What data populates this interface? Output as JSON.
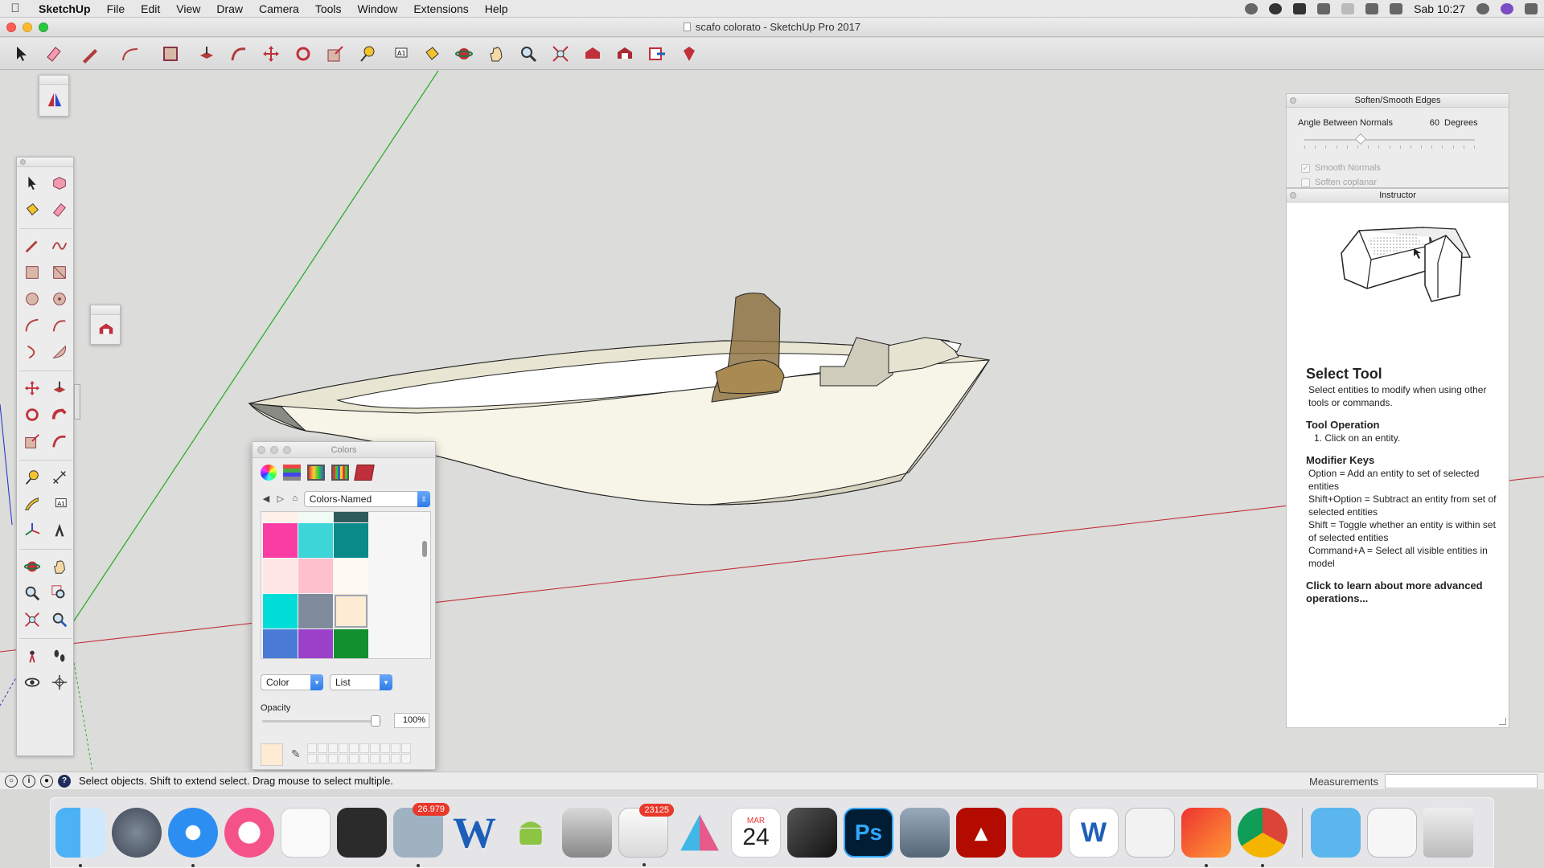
{
  "menubar": {
    "apple_icon": "apple-logo",
    "items": [
      "SketchUp",
      "File",
      "Edit",
      "View",
      "Draw",
      "Camera",
      "Tools",
      "Window",
      "Extensions",
      "Help"
    ],
    "clock": "Sab 10:27"
  },
  "window": {
    "title": "scafo colorato - SketchUp Pro 2017"
  },
  "colors_panel": {
    "title": "Colors",
    "palette_select": "Colors-Named",
    "mode_select": "Color",
    "view_select": "List",
    "opacity_label": "Opacity",
    "opacity_value": "100%",
    "opacity_fraction": 0.95,
    "selected_color": "#fdebd3",
    "swatches": [
      "#fdf1ea",
      "#effbf4",
      "#2f5b5d",
      "#fb3ea3",
      "#3dd5d8",
      "#0b8a8a",
      "#fee5e6",
      "#fec0cd",
      "#fefaf1",
      "#00dcd7",
      "#7f8b9a",
      "#fdebd3",
      "#4a7bd6",
      "#9b40c8",
      "#128f2e"
    ]
  },
  "soften_panel": {
    "title": "Soften/Smooth Edges",
    "angle_label": "Angle Between Normals",
    "angle_value": "60",
    "angle_unit": "Degrees",
    "angle_fraction": 0.33,
    "smooth_normals": "Smooth Normals",
    "soften_coplanar": "Soften coplanar"
  },
  "instructor": {
    "title": "Instructor",
    "tool_name": "Select Tool",
    "tool_desc": "Select entities to modify when using other tools or commands.",
    "op_heading": "Tool Operation",
    "op_1": "1. Click on an entity.",
    "mod_heading": "Modifier Keys",
    "mod_1": "Option = Add an entity to set of selected entities",
    "mod_2": "Shift+Option = Subtract an entity from set of selected entities",
    "mod_3": "Shift = Toggle whether an entity is within set of selected entities",
    "mod_4": "Command+A = Select all visible entities in model",
    "more_link": "Click to learn about more advanced operations..."
  },
  "statusbar": {
    "status": "Select objects. Shift to extend select. Drag mouse to select multiple.",
    "measurements_label": "Measurements"
  },
  "dock": {
    "badge_tweetbot": "26.979",
    "badge_mail": "23125",
    "calendar_month": "MAR",
    "calendar_day": "24"
  }
}
